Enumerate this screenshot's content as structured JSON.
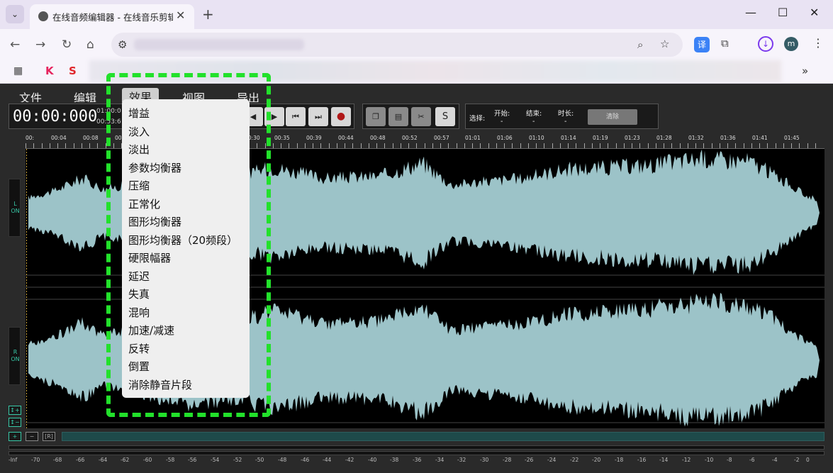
{
  "browser": {
    "tab_title": "在线音频编辑器 - 在线音乐剪辑",
    "tab_close": "✕",
    "new_tab": "+",
    "window_controls": {
      "minimize": "—",
      "maximize": "☐",
      "close": "✕"
    },
    "nav": {
      "back": "←",
      "forward": "→",
      "reload": "↻",
      "home": "⌂"
    },
    "extension_translate_label": "译",
    "avatar_letter": "m",
    "more_bookmarks": "»"
  },
  "app": {
    "menu": [
      "文件",
      "编辑",
      "效果",
      "视图",
      "导出"
    ],
    "time_display": "00:00:000",
    "time_small_1": "01:00:0",
    "time_small_2": "00:53:6",
    "edit_buttons": {
      "s_label": "S"
    },
    "selection": {
      "label": "选择:",
      "start_label": "开始:",
      "end_label": "结束:",
      "duration_label": "时长:",
      "start_value": "-",
      "end_value": "-",
      "duration_value": "-",
      "clear_label": "清除"
    },
    "timeline_labels": [
      "00:",
      "00:04",
      "00:08",
      "00:",
      "00:30",
      "00:35",
      "00:39",
      "00:44",
      "00:48",
      "00:52",
      "00:57",
      "01:01",
      "01:06",
      "01:10",
      "01:14",
      "01:19",
      "01:23",
      "01:28",
      "01:32",
      "01:36",
      "01:41",
      "01:45"
    ],
    "channels": {
      "left": {
        "name": "L",
        "state": "ON"
      },
      "right": {
        "name": "R",
        "state": "ON"
      }
    },
    "zoom_buttons": {
      "v_plus": "↕+",
      "v_minus": "↕−",
      "h_plus": "+",
      "h_minus": "−",
      "reset": "[R]"
    },
    "meter_labels": [
      "-Inf",
      "-70",
      "-68",
      "-66",
      "-64",
      "-62",
      "-60",
      "-58",
      "-56",
      "-54",
      "-52",
      "-50",
      "-48",
      "-46",
      "-44",
      "-42",
      "-40",
      "-38",
      "-36",
      "-34",
      "-32",
      "-30",
      "-28",
      "-26",
      "-24",
      "-22",
      "-20",
      "-18",
      "-16",
      "-14",
      "-12",
      "-10",
      "-8",
      "-6",
      "-4",
      "-2",
      "0"
    ],
    "effects_menu": [
      "增益",
      "淡入",
      "淡出",
      "参数均衡器",
      "压缩",
      "正常化",
      "图形均衡器",
      "图形均衡器（20频段）",
      "硬限幅器",
      "延迟",
      "失真",
      "混响",
      "加速/减速",
      "反转",
      "倒置",
      "消除静音片段"
    ]
  },
  "colors": {
    "waveform": "#9cc3c8",
    "highlight": "#22e12b",
    "accent": "#38c9a8"
  }
}
